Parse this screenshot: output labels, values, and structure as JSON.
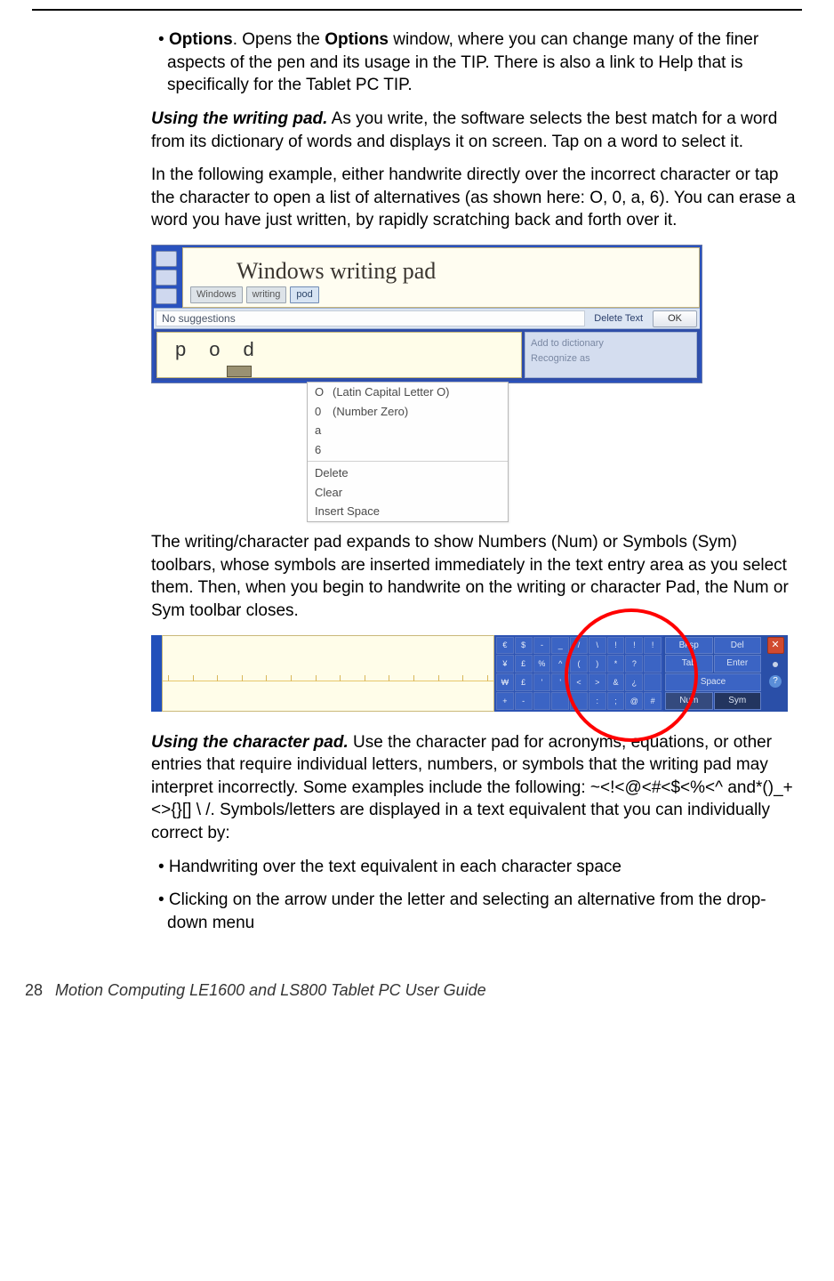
{
  "body": {
    "options_bullet_prefix": "• ",
    "options_bold1": "Options",
    "options_text1": ". Opens the ",
    "options_bold2": "Options",
    "options_text2": " window, where you can change many of the finer aspects of the pen and its usage in the TIP. There is also a link to Help that is specifically for the Tablet PC TIP.",
    "writing_pad_lead": "Using the writing pad.",
    "writing_pad_text": " As you write, the software selects the best match for a word from its dictionary of words and displays it on screen. Tap on a word to select it.",
    "example_text": "In the following example, either handwrite directly over the incorrect character or tap the character to open a list of alternatives (as shown here: O, 0, a, 6). You can erase a word you have just written, by rapidly scratching back and forth over it.",
    "after_fig1": "The writing/character pad expands to show Numbers (Num) or Symbols (Sym) toolbars, whose symbols are inserted immediately in the text entry area as you select them. Then, when you begin to handwrite on the writing or character Pad, the Num or Sym toolbar closes.",
    "char_pad_lead": "Using the character pad.",
    "char_pad_text": " Use the character pad for acronyms, equations, or other entries that require individual letters, numbers, or symbols that the writing pad may interpret incorrectly. Some examples include the following: ~<!<@<#<$<%<^ and*()_+<>{}[] \\ /. Symbols/letters are displayed in a text equivalent that you can individually correct by:",
    "sub1": "• Handwriting over the text equivalent in each character space",
    "sub2": "• Clicking on the arrow under the letter and selecting an alternative from the drop-down menu"
  },
  "fig1": {
    "handwriting": "Windows writing pad",
    "words": [
      "Windows",
      "writing",
      "pod"
    ],
    "no_suggestions": "No suggestions",
    "delete_text": "Delete Text",
    "ok": "OK",
    "chars": [
      "p",
      "o",
      "d"
    ],
    "add_dict": "Add to dictionary",
    "recognize": "Recognize as",
    "dropdown": [
      {
        "ch": "O",
        "desc": "(Latin Capital Letter O)"
      },
      {
        "ch": "0",
        "desc": "(Number Zero)"
      },
      {
        "ch": "a",
        "desc": ""
      },
      {
        "ch": "6",
        "desc": ""
      }
    ],
    "actions": [
      "Delete",
      "Clear",
      "Insert Space"
    ]
  },
  "fig2": {
    "keypad": [
      "€",
      "$",
      "-",
      "_",
      "/",
      "\\",
      "!",
      "!",
      "!",
      "¥",
      "£",
      "%",
      "^",
      "(",
      ")",
      "*",
      "?",
      "",
      "₩",
      "£",
      "'",
      "'",
      "<",
      ">",
      "&",
      "¿",
      "",
      "+",
      "-",
      "",
      "",
      "",
      ":",
      ";",
      "@",
      "#"
    ],
    "ctrl": {
      "bksp": "Bksp",
      "del": "Del",
      "tab": "Tab",
      "enter": "Enter",
      "space": "Space",
      "num": "Num",
      "sym": "Sym",
      "left": "←",
      "right": "→"
    }
  },
  "footer": {
    "page": "28",
    "title": "Motion Computing LE1600 and LS800 Tablet PC User Guide"
  }
}
